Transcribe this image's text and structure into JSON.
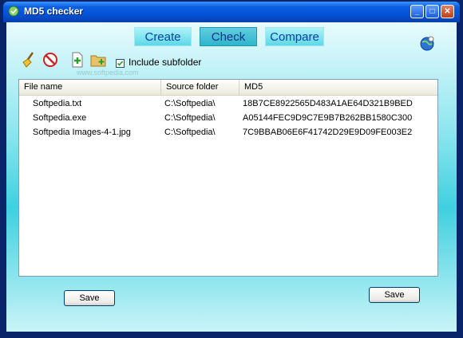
{
  "window": {
    "title": "MD5 checker",
    "minimize_label": "_",
    "maximize_label": "□",
    "close_label": "✕"
  },
  "tabs": [
    {
      "label": "Create"
    },
    {
      "label": "Check"
    },
    {
      "label": "Compare"
    }
  ],
  "toolbar": {
    "icons": [
      "broom-icon",
      "clear-icon",
      "add-file-icon",
      "add-folder-icon"
    ],
    "include_subfolder_label": "Include subfolder",
    "include_subfolder_checked": true
  },
  "watermark": "www.softpedia.com",
  "table": {
    "columns": [
      "File name",
      "Source folder",
      "MD5"
    ],
    "rows": [
      [
        "Softpedia.txt",
        "C:\\Softpedia\\",
        "18B7CE8922565D483A1AE64D321B9BED"
      ],
      [
        "Softpedia.exe",
        "C:\\Softpedia\\",
        "A05144FEC9D9C7E9B7B262BB1580C300"
      ],
      [
        "Softpedia Images-4-1.jpg",
        "C:\\Softpedia\\",
        "7C9BBAB06E6F41742D29E9D09FE003E2"
      ]
    ]
  },
  "buttons": {
    "save_left": "Save",
    "save_right": "Save"
  },
  "colors": {
    "title_bar": "#0453d8",
    "panel": "#3fd0df",
    "tab_text": "#0a3fa8"
  }
}
